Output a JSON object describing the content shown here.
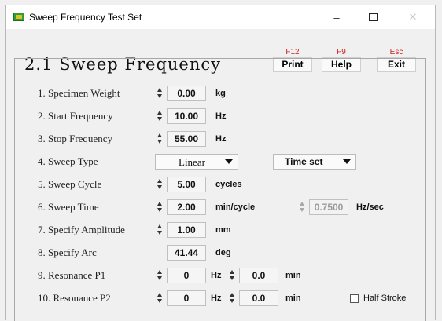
{
  "window": {
    "title": "Sweep Frequency Test Set",
    "controls": {
      "minimize": "–",
      "close": "✕"
    }
  },
  "header": {
    "title": "2.1 Sweep Frequency",
    "buttons": [
      {
        "key": "F12",
        "label": "Print"
      },
      {
        "key": "F9",
        "label": "Help"
      },
      {
        "key": "Esc",
        "label": "Exit"
      }
    ]
  },
  "rows": {
    "specimen_weight": {
      "label": "1. Specimen Weight",
      "value": "0.00",
      "unit": "kg"
    },
    "start_frequency": {
      "label": "2. Start Frequency",
      "value": "10.00",
      "unit": "Hz"
    },
    "stop_frequency": {
      "label": "3. Stop  Frequency",
      "value": "55.00",
      "unit": "Hz"
    },
    "sweep_type": {
      "label": "4. Sweep Type",
      "mode": "Linear",
      "timing": "Time set"
    },
    "sweep_cycle": {
      "label": "5. Sweep Cycle",
      "value": "5.00",
      "unit": "cycles"
    },
    "sweep_time": {
      "label": "6. Sweep Time",
      "value": "2.00",
      "unit": "min/cycle",
      "rate_value": "0.7500",
      "rate_unit": "Hz/sec"
    },
    "specify_amplitude": {
      "label": "7. Specify Amplitude",
      "value": "1.00",
      "unit": "mm"
    },
    "specify_arc": {
      "label": "8. Specify Arc",
      "value": "41.44",
      "unit": "deg"
    },
    "resonance_p1": {
      "label": "9. Resonance P1",
      "freq": "0",
      "freq_unit": "Hz",
      "time": "0.0",
      "time_unit": "min"
    },
    "resonance_p2": {
      "label": "10. Resonance P2",
      "freq": "0",
      "freq_unit": "Hz",
      "time": "0.0",
      "time_unit": "min"
    }
  },
  "half_stroke": {
    "label": "Half Stroke",
    "checked": false
  }
}
